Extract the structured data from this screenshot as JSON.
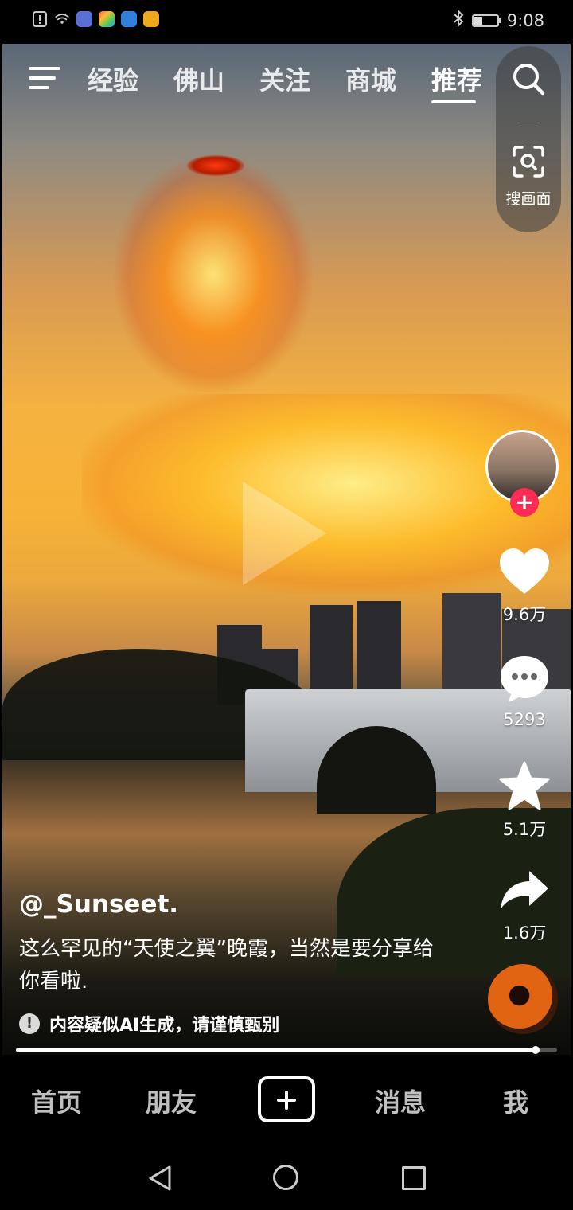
{
  "status_bar": {
    "time": "9:08",
    "battery_level": 0.35,
    "icons": [
      "alert-icon",
      "wifi-icon",
      "music-app-icon",
      "gallery-app-icon",
      "browser-app-icon",
      "video-app-icon",
      "bluetooth-icon",
      "battery-icon"
    ]
  },
  "top_tabs": {
    "items": [
      "经验",
      "佛山",
      "关注",
      "商城",
      "推荐"
    ],
    "active": "推荐"
  },
  "search_panel": {
    "scan_label": "搜画面"
  },
  "actions": {
    "likes": "9.6万",
    "comments": "5293",
    "favorites": "5.1万",
    "shares": "1.6万"
  },
  "caption": {
    "author": "@_Sunseet.",
    "description": "这么罕见的“天使之翼”晚霞，当然是要分享给你看啦.",
    "ai_notice": "内容疑似AI生成，请谨慎甄别"
  },
  "playback": {
    "progress": 0.96
  },
  "bottom_nav": {
    "home": "首页",
    "friends": "朋友",
    "messages": "消息",
    "me": "我"
  },
  "colors": {
    "follow_accent": "#fe2c55",
    "background": "#000000"
  }
}
